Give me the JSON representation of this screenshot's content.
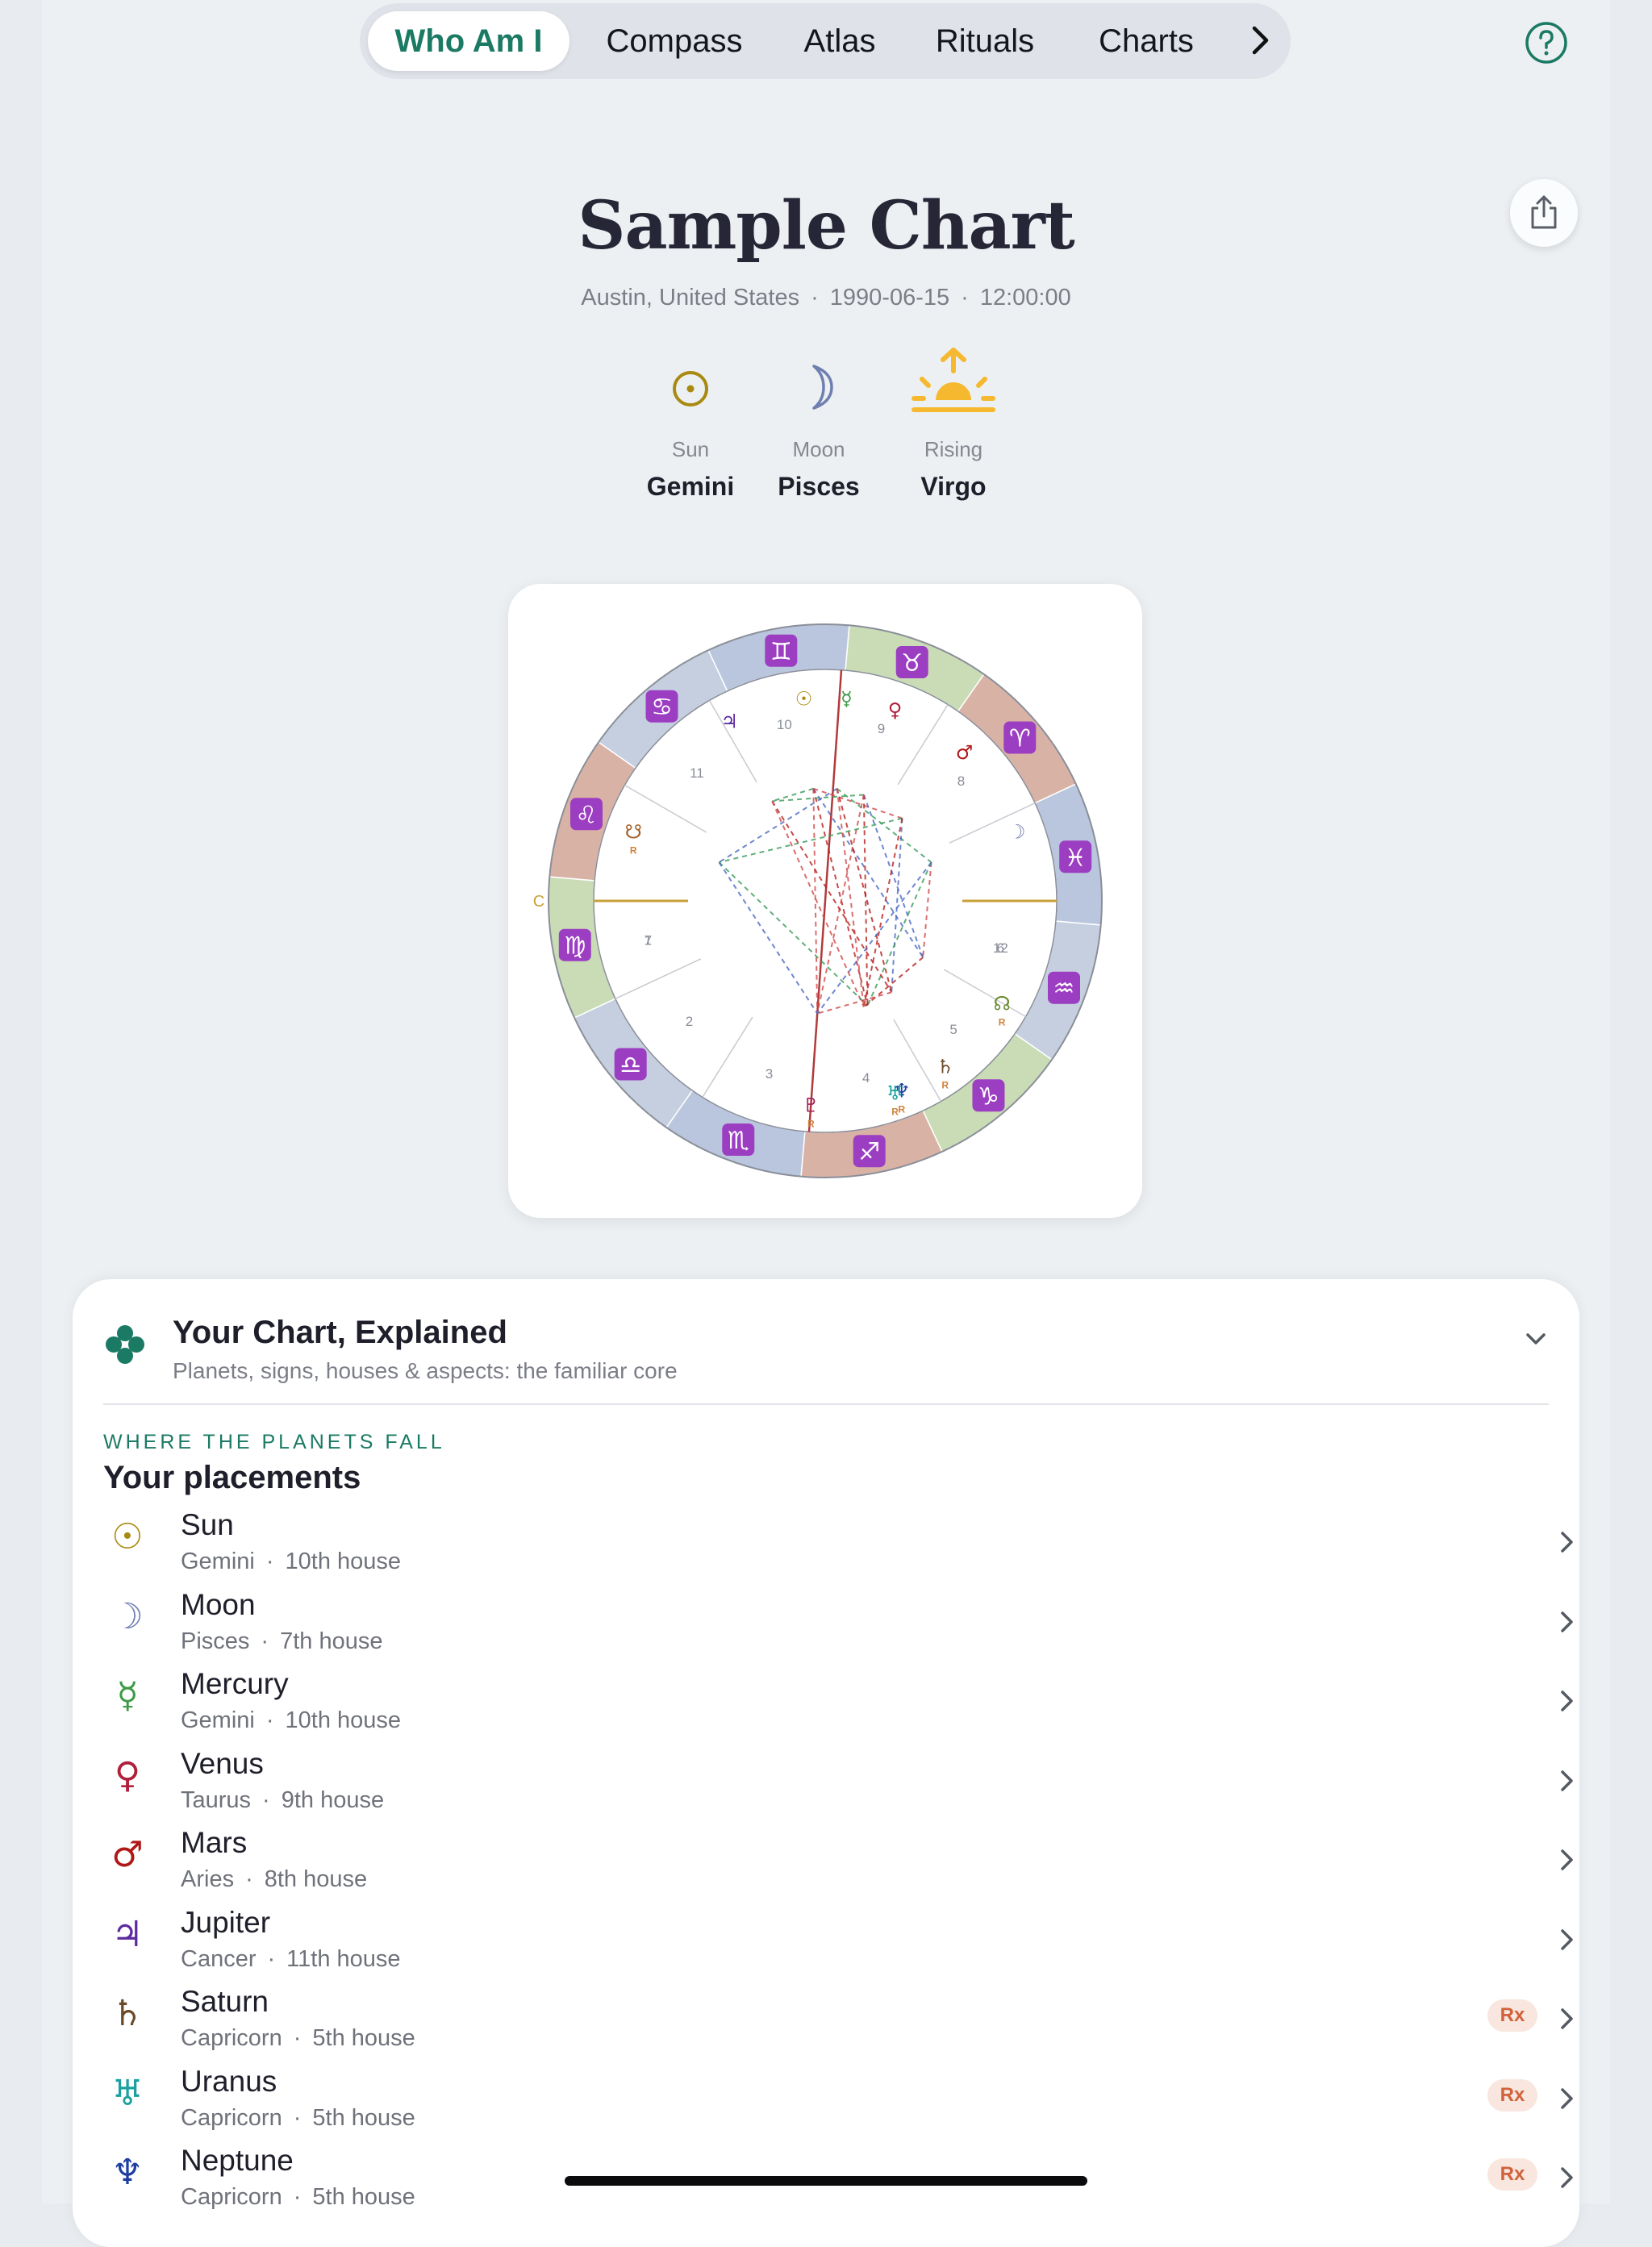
{
  "nav": {
    "tabs": [
      {
        "label": "Who Am I",
        "active": true
      },
      {
        "label": "Compass",
        "active": false
      },
      {
        "label": "Atlas",
        "active": false
      },
      {
        "label": "Rituals",
        "active": false
      },
      {
        "label": "Charts",
        "active": false
      }
    ],
    "more_icon": "chevron-right-icon",
    "help_icon": "question-circle-icon"
  },
  "header": {
    "title": "Sample Chart",
    "location": "Austin, United States",
    "date": "1990-06-15",
    "time": "12:00:00",
    "separator": "·",
    "share_icon": "share-icon"
  },
  "big_three": [
    {
      "label": "Sun",
      "value": "Gemini",
      "icon": "sun-glyph-icon"
    },
    {
      "label": "Moon",
      "value": "Pisces",
      "icon": "moon-glyph-icon"
    },
    {
      "label": "Rising",
      "value": "Virgo",
      "icon": "sunrise-icon"
    }
  ],
  "wheel": {
    "signs": [
      "♈",
      "♉",
      "♊",
      "♋",
      "♌",
      "♍",
      "♎",
      "♏",
      "♐",
      "♑",
      "♒",
      "♓"
    ],
    "house_numbers": [
      "1",
      "2",
      "3",
      "4",
      "5",
      "6",
      "7",
      "8",
      "9",
      "10",
      "11",
      "12"
    ],
    "asc_label": "C",
    "retro_mark": "R",
    "planets": [
      {
        "glyph": "☉",
        "color": "#a88a10",
        "retro": false
      },
      {
        "glyph": "☿",
        "color": "#3e9a46",
        "retro": false
      },
      {
        "glyph": "♀",
        "color": "#b0203a",
        "retro": false
      },
      {
        "glyph": "♂",
        "color": "#b01818",
        "retro": false
      },
      {
        "glyph": "☽",
        "color": "#6f7fb0",
        "retro": false
      },
      {
        "glyph": "♃",
        "color": "#5d2aa0",
        "retro": false
      },
      {
        "glyph": "☋",
        "color": "#a5612a",
        "retro": true
      },
      {
        "glyph": "☊",
        "color": "#6a8a30",
        "retro": true
      },
      {
        "glyph": "♄",
        "color": "#6b4a2a",
        "retro": true
      },
      {
        "glyph": "♆",
        "color": "#1d3da0",
        "retro": true
      },
      {
        "glyph": "♅",
        "color": "#1aa0a0",
        "retro": true
      },
      {
        "glyph": "♇",
        "color": "#a0205a",
        "retro": true
      }
    ]
  },
  "explained": {
    "title": "Your Chart, Explained",
    "subtitle": "Planets, signs, houses & aspects: the familiar core",
    "kicker": "WHERE THE PLANETS FALL",
    "section_title": "Your placements"
  },
  "placements": [
    {
      "glyph": "☉",
      "color": "#a88a10",
      "name": "Sun",
      "sign": "Gemini",
      "house": "10th house",
      "rx": ""
    },
    {
      "glyph": "☽",
      "color": "#6f7fb0",
      "name": "Moon",
      "sign": "Pisces",
      "house": "7th house",
      "rx": ""
    },
    {
      "glyph": "☿",
      "color": "#3e9a46",
      "name": "Mercury",
      "sign": "Gemini",
      "house": "10th house",
      "rx": ""
    },
    {
      "glyph": "♀",
      "color": "#b0203a",
      "name": "Venus",
      "sign": "Taurus",
      "house": "9th house",
      "rx": ""
    },
    {
      "glyph": "♂",
      "color": "#b01818",
      "name": "Mars",
      "sign": "Aries",
      "house": "8th house",
      "rx": ""
    },
    {
      "glyph": "♃",
      "color": "#5d2aa0",
      "name": "Jupiter",
      "sign": "Cancer",
      "house": "11th house",
      "rx": ""
    },
    {
      "glyph": "♄",
      "color": "#6b4a2a",
      "name": "Saturn",
      "sign": "Capricorn",
      "house": "5th house",
      "rx": "Rx"
    },
    {
      "glyph": "♅",
      "color": "#1aa0a0",
      "name": "Uranus",
      "sign": "Capricorn",
      "house": "5th house",
      "rx": "Rx"
    },
    {
      "glyph": "♆",
      "color": "#1d3da0",
      "name": "Neptune",
      "sign": "Capricorn",
      "house": "5th house",
      "rx": "Rx"
    }
  ]
}
